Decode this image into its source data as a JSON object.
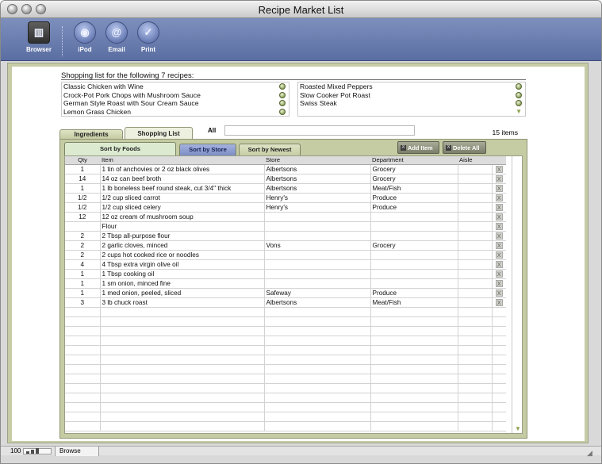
{
  "window": {
    "title": "Recipe Market List"
  },
  "toolbar": {
    "buttons": [
      {
        "label": "Browser",
        "icon": "browser-icon"
      },
      {
        "label": "iPod",
        "icon": "ipod-icon"
      },
      {
        "label": "Email",
        "icon": "email-icon"
      },
      {
        "label": "Print",
        "icon": "print-icon"
      }
    ]
  },
  "heading": "Shopping list for the following 7 recipes:",
  "recipes_left": [
    "Classic Chicken with Wine",
    "Crock-Pot Pork Chops with Mushroom Sauce",
    "German Style Roast with Sour Cream Sauce",
    "Lemon Grass Chicken"
  ],
  "recipes_right": [
    "Roasted Mixed Peppers",
    "Slow Cooker Pot Roast",
    "Swiss Steak"
  ],
  "tabs": {
    "ingredients": "Ingredients",
    "shopping_list": "Shopping List"
  },
  "filter": {
    "label": "All",
    "value": ""
  },
  "items_count": "15 items",
  "sort_tabs": {
    "foods": "Sort by Foods",
    "store": "Sort by Store",
    "newest": "Sort by Newest"
  },
  "actions": {
    "add_item": "Add Item",
    "delete_all": "Delete All",
    "delete_glyph": "X"
  },
  "columns": {
    "qty": "Qty",
    "item": "Item",
    "store": "Store",
    "department": "Department",
    "aisle": "Aisle"
  },
  "rows": [
    {
      "qty": "1",
      "item": "1 tin of anchovies or 2 oz black olives",
      "store": "Albertsons",
      "department": "Grocery",
      "aisle": ""
    },
    {
      "qty": "14",
      "item": "14 oz can beef broth",
      "store": "Albertsons",
      "department": "Grocery",
      "aisle": ""
    },
    {
      "qty": "1",
      "item": "1 lb boneless beef round steak, cut 3/4\" thick",
      "store": "Albertsons",
      "department": "Meat/Fish",
      "aisle": ""
    },
    {
      "qty": "1/2",
      "item": "1/2 cup sliced carrot",
      "store": "Henry's",
      "department": "Produce",
      "aisle": ""
    },
    {
      "qty": "1/2",
      "item": "1/2 cup sliced celery",
      "store": "Henry's",
      "department": "Produce",
      "aisle": ""
    },
    {
      "qty": "12",
      "item": "12 oz cream of mushroom soup",
      "store": "",
      "department": "",
      "aisle": ""
    },
    {
      "qty": "",
      "item": "Flour",
      "store": "",
      "department": "",
      "aisle": ""
    },
    {
      "qty": "2",
      "item": "2 Tbsp all-purpose flour",
      "store": "",
      "department": "",
      "aisle": ""
    },
    {
      "qty": "2",
      "item": "2 garlic cloves, minced",
      "store": "Vons",
      "department": "Grocery",
      "aisle": ""
    },
    {
      "qty": "2",
      "item": "2 cups hot cooked rice or noodles",
      "store": "",
      "department": "",
      "aisle": ""
    },
    {
      "qty": "4",
      "item": "4 Tbsp extra virgin olive oil",
      "store": "",
      "department": "",
      "aisle": ""
    },
    {
      "qty": "1",
      "item": "1 Tbsp cooking oil",
      "store": "",
      "department": "",
      "aisle": ""
    },
    {
      "qty": "1",
      "item": "1 sm onion, minced fine",
      "store": "",
      "department": "",
      "aisle": ""
    },
    {
      "qty": "1",
      "item": "1 med onion, peeled, sliced",
      "store": "Safeway",
      "department": "Produce",
      "aisle": ""
    },
    {
      "qty": "3",
      "item": "3 lb chuck roast",
      "store": "Albertsons",
      "department": "Meat/Fish",
      "aisle": ""
    }
  ],
  "status": {
    "zoom": "100",
    "mode": "Browse"
  }
}
